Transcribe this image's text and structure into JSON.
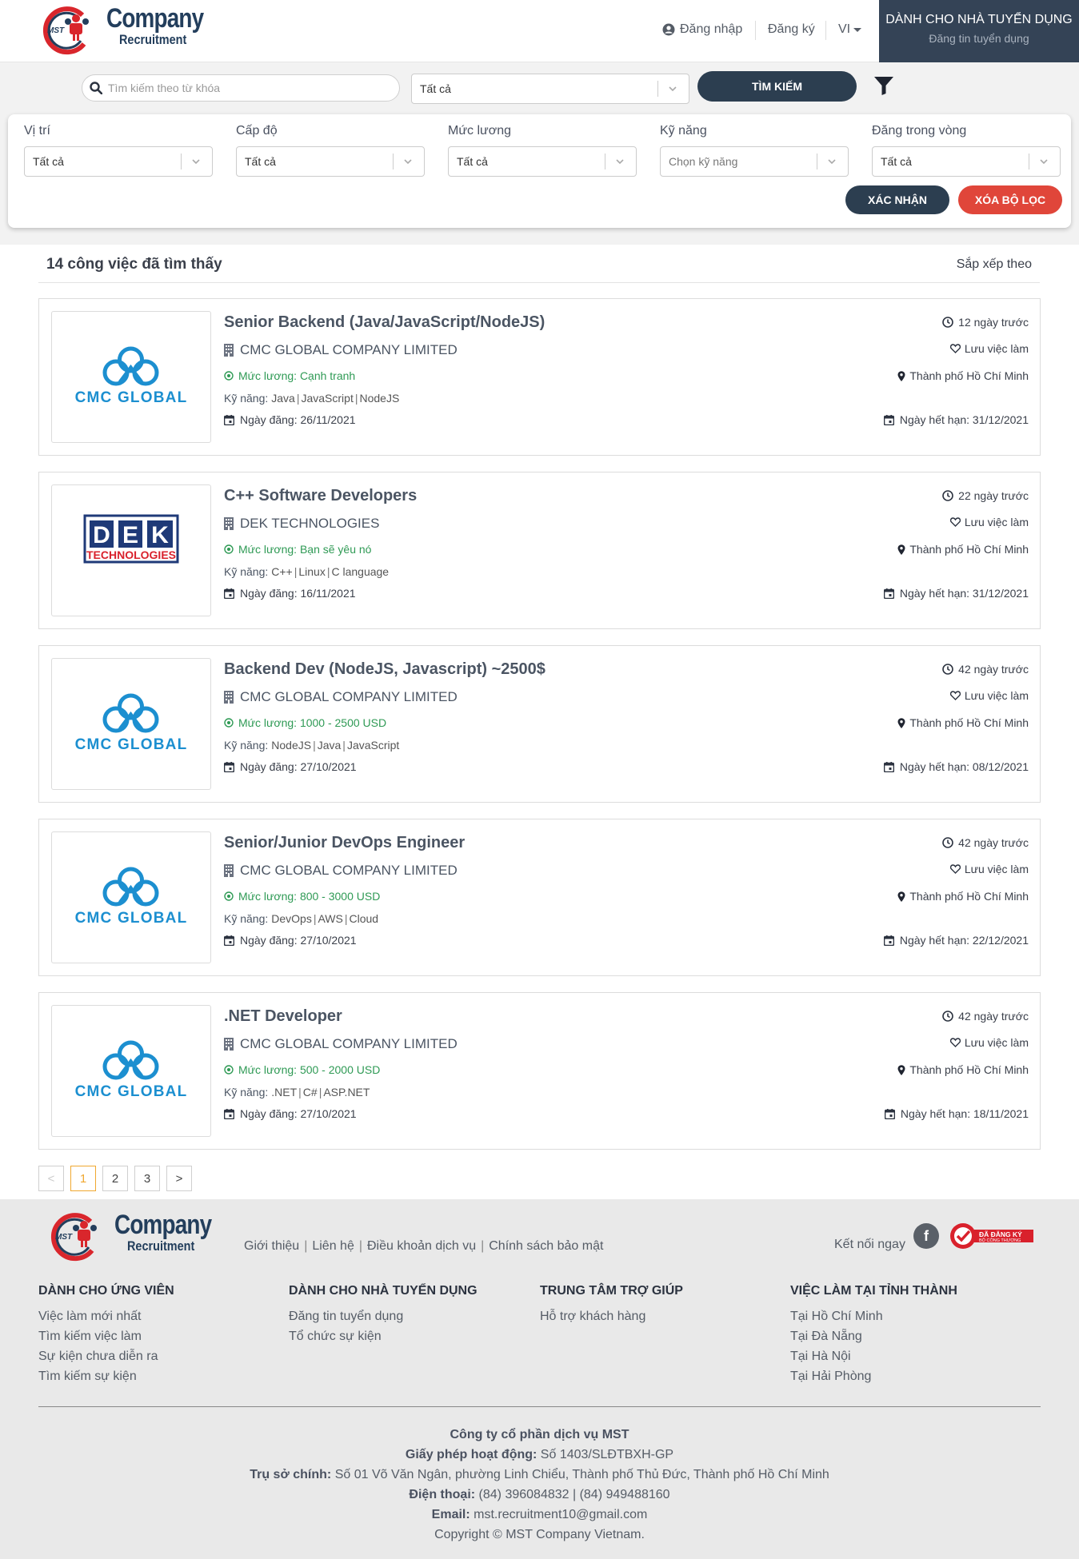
{
  "brand": {
    "logo_mark": "MST",
    "name": "Company",
    "tagline": "Recruitment"
  },
  "header": {
    "login": "Đăng nhập",
    "register": "Đăng ký",
    "language": "VI",
    "employer_title": "DÀNH CHO NHÀ TUYỂN DỤNG",
    "employer_sub": "Đăng tin tuyển dụng"
  },
  "search": {
    "keyword_placeholder": "Tìm kiếm theo từ khóa",
    "category_value": "Tất cả",
    "search_button": "TÌM KIẾM"
  },
  "filters": {
    "position": {
      "label": "Vị trí",
      "value": "Tất cả"
    },
    "level": {
      "label": "Cấp độ",
      "value": "Tất cả"
    },
    "salary": {
      "label": "Mức lương",
      "value": "Tất cả"
    },
    "skills": {
      "label": "Kỹ năng",
      "value": "Chọn kỹ năng"
    },
    "posted_within": {
      "label": "Đăng trong vòng",
      "value": "Tất cả"
    },
    "confirm_button": "XÁC NHẬN",
    "clear_button": "XÓA BỘ LỌC"
  },
  "results": {
    "count_text": "14 công việc đã tìm thấy",
    "sort_label": "Sắp xếp theo"
  },
  "jobs": [
    {
      "logo": "CMC GLOBAL",
      "title": "Senior Backend (Java/JavaScript/NodeJS)",
      "company": "CMC GLOBAL COMPANY LIMITED",
      "salary": "Mức lương: Cạnh tranh",
      "skills_label": "Kỹ năng:",
      "skills": [
        "Java",
        "JavaScript",
        "NodeJS"
      ],
      "posted": "Ngày đăng: 26/11/2021",
      "ago": "12 ngày trước",
      "save": "Lưu việc làm",
      "location": "Thành phố Hồ Chí Minh",
      "expire": "Ngày hết hạn: 31/12/2021"
    },
    {
      "logo": "DEK TECHNOLOGIES",
      "title": "C++ Software Developers",
      "company": "DEK TECHNOLOGIES",
      "salary": "Mức lương: Bạn sẽ yêu nó",
      "skills_label": "Kỹ năng:",
      "skills": [
        "C++",
        "Linux",
        "C language"
      ],
      "posted": "Ngày đăng: 16/11/2021",
      "ago": "22 ngày trước",
      "save": "Lưu việc làm",
      "location": "Thành phố Hồ Chí Minh",
      "expire": "Ngày hết hạn: 31/12/2021"
    },
    {
      "logo": "CMC GLOBAL",
      "title": "Backend Dev (NodeJS, Javascript) ~2500$",
      "company": "CMC GLOBAL COMPANY LIMITED",
      "salary": "Mức lương: 1000 - 2500 USD",
      "skills_label": "Kỹ năng:",
      "skills": [
        "NodeJS",
        "Java",
        "JavaScript"
      ],
      "posted": "Ngày đăng: 27/10/2021",
      "ago": "42 ngày trước",
      "save": "Lưu việc làm",
      "location": "Thành phố Hồ Chí Minh",
      "expire": "Ngày hết hạn: 08/12/2021"
    },
    {
      "logo": "CMC GLOBAL",
      "title": "Senior/Junior DevOps Engineer",
      "company": "CMC GLOBAL COMPANY LIMITED",
      "salary": "Mức lương: 800 - 3000 USD",
      "skills_label": "Kỹ năng:",
      "skills": [
        "DevOps",
        "AWS",
        "Cloud"
      ],
      "posted": "Ngày đăng: 27/10/2021",
      "ago": "42 ngày trước",
      "save": "Lưu việc làm",
      "location": "Thành phố Hồ Chí Minh",
      "expire": "Ngày hết hạn: 22/12/2021"
    },
    {
      "logo": "CMC GLOBAL",
      "title": ".NET Developer",
      "company": "CMC GLOBAL COMPANY LIMITED",
      "salary": "Mức lương: 500 - 2000 USD",
      "skills_label": "Kỹ năng:",
      "skills": [
        ".NET",
        "C#",
        "ASP.NET"
      ],
      "posted": "Ngày đăng: 27/10/2021",
      "ago": "42 ngày trước",
      "save": "Lưu việc làm",
      "location": "Thành phố Hồ Chí Minh",
      "expire": "Ngày hết hạn: 18/11/2021"
    }
  ],
  "pagination": {
    "prev": "<",
    "pages": [
      "1",
      "2",
      "3"
    ],
    "active": "1",
    "next": ">"
  },
  "footer": {
    "links": [
      "Giới thiệu",
      "Liên hệ",
      "Điều khoản dịch vụ",
      "Chính sách bảo mật"
    ],
    "connect": "Kết nối ngay",
    "facebook": "f",
    "badge_line1": "ĐÃ ĐĂNG KÝ",
    "badge_line2": "BỘ CÔNG THƯƠNG",
    "columns": [
      {
        "title": "DÀNH CHO ỨNG VIÊN",
        "items": [
          "Việc làm mới nhất",
          "Tìm kiếm việc làm",
          "Sự kiện chưa diễn ra",
          "Tìm kiếm sự kiện"
        ]
      },
      {
        "title": "DÀNH CHO NHÀ TUYỂN DỤNG",
        "items": [
          "Đăng tin tuyển dụng",
          "Tổ chức sự kiện"
        ]
      },
      {
        "title": "TRUNG TÂM TRỢ GIÚP",
        "items": [
          "Hỗ trợ khách hàng"
        ]
      },
      {
        "title": "VIỆC LÀM TẠI TỈNH THÀNH",
        "items": [
          "Tại Hồ Chí Minh",
          "Tại Đà Nẵng",
          "Tại Hà Nội",
          "Tại Hải Phòng"
        ]
      }
    ],
    "company_name": "Công ty cổ phần dịch vụ MST",
    "license_label": "Giấy phép hoạt động:",
    "license_value": "Số 1403/SLĐTBXH-GP",
    "hq_label": "Trụ sở chính:",
    "hq_value": "Số 01 Võ Văn Ngân, phường Linh Chiểu, Thành phố Thủ Đức, Thành phố Hồ Chí Minh",
    "phone_label": "Điện thoại:",
    "phone_value": "(84) 396084832 | (84) 949488160",
    "email_label": "Email:",
    "email_value": "mst.recruitment10@gmail.com",
    "copyright": "Copyright © MST Company Vietnam."
  },
  "colors": {
    "navy": "#2c3e50",
    "employer_bg": "#344356",
    "danger": "#e0463a",
    "salary_green": "#2f9a55",
    "cmc_blue": "#1c8fd0",
    "dek_navy": "#1f3a78",
    "dek_red": "#d9212c",
    "brand_red": "#d9262c",
    "active_page": "#f0a830"
  },
  "icons": [
    "search-icon",
    "user-circle-icon",
    "filter-icon",
    "chevron-down-icon",
    "building-icon",
    "money-icon",
    "calendar-icon",
    "clock-icon",
    "heart-icon",
    "map-pin-icon",
    "facebook-icon"
  ]
}
